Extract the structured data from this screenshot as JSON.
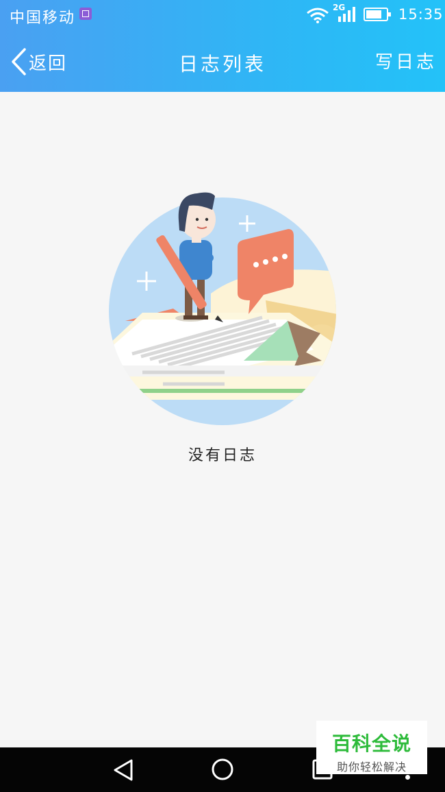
{
  "status_bar": {
    "carrier": "中国移动",
    "network": "2G",
    "time": "15:35",
    "battery_level": 0.7
  },
  "navbar": {
    "back_label": "返回",
    "title": "日志列表",
    "write_label": "写日志"
  },
  "empty_state": {
    "message": "没有日志"
  },
  "watermark": {
    "title": "百科全说",
    "subtitle": "助你轻松解决"
  },
  "colors": {
    "header_gradient_start": "#4aa0f2",
    "header_gradient_end": "#23c2f8",
    "background": "#f6f6f6",
    "watermark_green": "#2dbb3a"
  },
  "icons": [
    "sim-icon",
    "wifi-icon",
    "signal-icon",
    "battery-icon",
    "chevron-left-icon",
    "nav-back-icon",
    "nav-home-icon",
    "nav-recent-icon",
    "nav-menu-icon"
  ]
}
